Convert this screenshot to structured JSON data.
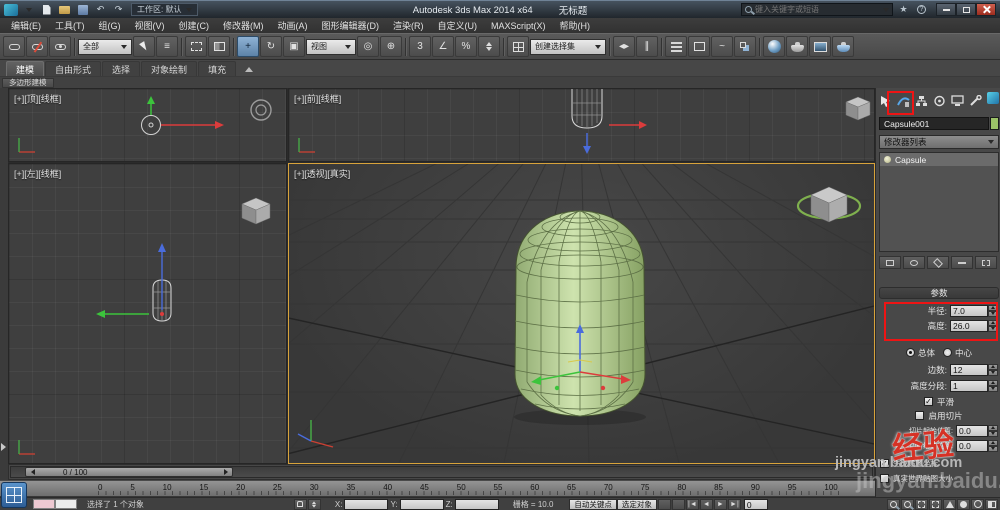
{
  "titlebar": {
    "app_title": "Autodesk 3ds Max  2014 x64",
    "doc_title": "无标题",
    "workspace_selector": "工作区: 默认",
    "search_placeholder": "键入关键字或短语"
  },
  "menubar": {
    "items": [
      "编辑(E)",
      "工具(T)",
      "组(G)",
      "视图(V)",
      "创建(C)",
      "修改器(M)",
      "动画(A)",
      "图形编辑器(D)",
      "渲染(R)",
      "自定义(U)",
      "MAXScript(X)",
      "帮助(H)"
    ]
  },
  "toolbar": {
    "selection_filter": "全部",
    "reference_coordsys": "视图",
    "named_selection_sets": "创建选择集"
  },
  "icons": {
    "undo": "↶",
    "redo": "↷",
    "star": "★",
    "help": "?",
    "select_by_name": "≡",
    "move": "+",
    "rotate": "↻",
    "scale": "▣",
    "pivot": "◎",
    "manipulate": "⊕",
    "snap_3d": "3",
    "angle_snap": "∠",
    "percent_snap": "%",
    "mirror": "◂▸",
    "align": "∥",
    "curve_editor": "~",
    "check": "✓",
    "playback_start": "|◄",
    "playback_prev": "◄",
    "playback_play": "►",
    "playback_end": "►|"
  },
  "ribbon": {
    "tabs": [
      "建模",
      "自由形式",
      "选择",
      "对象绘制",
      "填充"
    ],
    "collapsed_panel": "多边形建模"
  },
  "viewports": {
    "top_label": "[+][顶][线框]",
    "left_label": "[+][左][线框]",
    "front_label": "[+][前][线框]",
    "persp_label": "[+][透视][真实]"
  },
  "command_panel": {
    "object_name": "Capsule001",
    "modifier_list": "修改器列表",
    "stack_items": [
      "Capsule"
    ],
    "rollout_title": "参数",
    "params": {
      "radius_label": "半径:",
      "radius_value": "7.0",
      "height_label": "高度:",
      "height_value": "26.0",
      "overall_label": "总体",
      "centers_label": "中心",
      "sides_label": "边数:",
      "sides_value": "12",
      "height_segs_label": "高度分段:",
      "height_segs_value": "1",
      "smooth_label": "平滑",
      "slice_on_label": "启用切片",
      "slice_from_label": "切片起始位置:",
      "slice_from_value": "0.0",
      "slice_to_label": "切片结束位置:",
      "slice_to_value": "0.0",
      "gen_mapping_label": "生成贴图坐标",
      "real_world_label": "真实世界贴图大小"
    }
  },
  "timeline": {
    "slider_value": "0 / 100",
    "ticks": [
      "0",
      "5",
      "10",
      "15",
      "20",
      "25",
      "30",
      "35",
      "40",
      "45",
      "50",
      "55",
      "60",
      "65",
      "70",
      "75",
      "80",
      "85",
      "90",
      "95",
      "100"
    ]
  },
  "statusbar": {
    "selection_status": "选择了 1 个对象",
    "x_label": "X:",
    "y_label": "Y:",
    "z_label": "Z:",
    "grid_readout": "栅格 = 10.0",
    "auto_key": "自动关键点",
    "selected_filter": "选定对象",
    "frame": "0"
  },
  "watermark": {
    "badge": "经验",
    "site": "jingyan.baidu.com"
  }
}
